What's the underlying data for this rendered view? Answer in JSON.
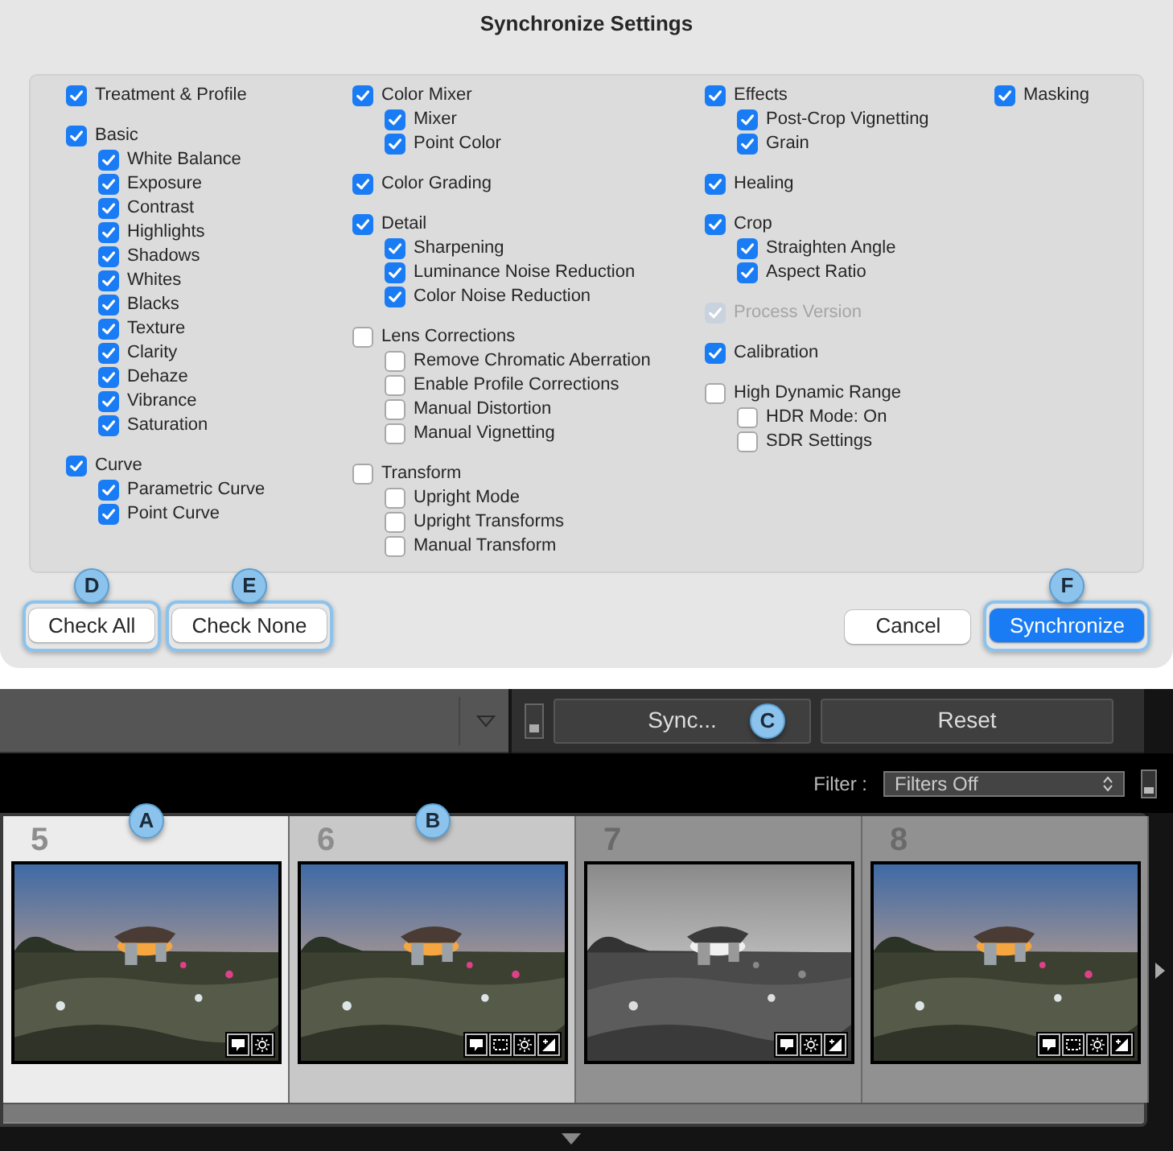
{
  "dialog": {
    "title": "Synchronize Settings",
    "columns": [
      [
        {
          "label": "Treatment & Profile",
          "checked": true,
          "disabled": false
        },
        {
          "label": "Basic",
          "checked": true,
          "disabled": false,
          "children": [
            {
              "label": "White Balance",
              "checked": true,
              "disabled": false
            },
            {
              "label": "Exposure",
              "checked": true,
              "disabled": false
            },
            {
              "label": "Contrast",
              "checked": true,
              "disabled": false
            },
            {
              "label": "Highlights",
              "checked": true,
              "disabled": false
            },
            {
              "label": "Shadows",
              "checked": true,
              "disabled": false
            },
            {
              "label": "Whites",
              "checked": true,
              "disabled": false
            },
            {
              "label": "Blacks",
              "checked": true,
              "disabled": false
            },
            {
              "label": "Texture",
              "checked": true,
              "disabled": false
            },
            {
              "label": "Clarity",
              "checked": true,
              "disabled": false
            },
            {
              "label": "Dehaze",
              "checked": true,
              "disabled": false
            },
            {
              "label": "Vibrance",
              "checked": true,
              "disabled": false
            },
            {
              "label": "Saturation",
              "checked": true,
              "disabled": false
            }
          ]
        },
        {
          "label": "Curve",
          "checked": true,
          "disabled": false,
          "children": [
            {
              "label": "Parametric Curve",
              "checked": true,
              "disabled": false
            },
            {
              "label": "Point Curve",
              "checked": true,
              "disabled": false
            }
          ]
        }
      ],
      [
        {
          "label": "Color Mixer",
          "checked": true,
          "disabled": false,
          "children": [
            {
              "label": "Mixer",
              "checked": true,
              "disabled": false
            },
            {
              "label": "Point Color",
              "checked": true,
              "disabled": false
            }
          ]
        },
        {
          "label": "Color Grading",
          "checked": true,
          "disabled": false
        },
        {
          "label": "Detail",
          "checked": true,
          "disabled": false,
          "children": [
            {
              "label": "Sharpening",
              "checked": true,
              "disabled": false
            },
            {
              "label": "Luminance Noise Reduction",
              "checked": true,
              "disabled": false
            },
            {
              "label": "Color Noise Reduction",
              "checked": true,
              "disabled": false
            }
          ]
        },
        {
          "label": "Lens Corrections",
          "checked": false,
          "disabled": false,
          "children": [
            {
              "label": "Remove Chromatic Aberration",
              "checked": false,
              "disabled": false
            },
            {
              "label": "Enable Profile Corrections",
              "checked": false,
              "disabled": false
            },
            {
              "label": "Manual Distortion",
              "checked": false,
              "disabled": false
            },
            {
              "label": "Manual Vignetting",
              "checked": false,
              "disabled": false
            }
          ]
        },
        {
          "label": "Transform",
          "checked": false,
          "disabled": false,
          "children": [
            {
              "label": "Upright Mode",
              "checked": false,
              "disabled": false
            },
            {
              "label": "Upright Transforms",
              "checked": false,
              "disabled": false
            },
            {
              "label": "Manual Transform",
              "checked": false,
              "disabled": false
            }
          ]
        }
      ],
      [
        {
          "label": "Effects",
          "checked": true,
          "disabled": false,
          "children": [
            {
              "label": "Post-Crop Vignetting",
              "checked": true,
              "disabled": false
            },
            {
              "label": "Grain",
              "checked": true,
              "disabled": false
            }
          ]
        },
        {
          "label": "Healing",
          "checked": true,
          "disabled": false
        },
        {
          "label": "Crop",
          "checked": true,
          "disabled": false,
          "children": [
            {
              "label": "Straighten Angle",
              "checked": true,
              "disabled": false
            },
            {
              "label": "Aspect Ratio",
              "checked": true,
              "disabled": false
            }
          ]
        },
        {
          "label": "Process Version",
          "checked": true,
          "disabled": true
        },
        {
          "label": "Calibration",
          "checked": true,
          "disabled": false
        },
        {
          "label": "High Dynamic Range",
          "checked": false,
          "disabled": false,
          "children": [
            {
              "label": "HDR Mode: On",
              "checked": false,
              "disabled": false
            },
            {
              "label": "SDR Settings",
              "checked": false,
              "disabled": false
            }
          ]
        }
      ],
      [
        {
          "label": "Masking",
          "checked": true,
          "disabled": false
        }
      ]
    ],
    "left_buttons": [
      {
        "label": "Check All",
        "callout": "D",
        "primary": false
      },
      {
        "label": "Check None",
        "callout": "E",
        "primary": false
      }
    ],
    "right_buttons": [
      {
        "label": "Cancel",
        "primary": false
      },
      {
        "label": "Synchronize",
        "callout": "F",
        "primary": true
      }
    ]
  },
  "toolbar": {
    "sync_button": {
      "label": "Sync...",
      "callout": "C"
    },
    "reset_button": {
      "label": "Reset"
    }
  },
  "filter": {
    "label": "Filter :",
    "value": "Filters Off"
  },
  "filmstrip": [
    {
      "number": "5",
      "active": true,
      "selected": true,
      "grayscale": false,
      "callout": "A",
      "commented": true,
      "cropped": false,
      "developed": true,
      "tone_adjusted": false
    },
    {
      "number": "6",
      "active": false,
      "selected": true,
      "grayscale": false,
      "callout": "B",
      "commented": true,
      "cropped": true,
      "developed": true,
      "tone_adjusted": true
    },
    {
      "number": "7",
      "active": false,
      "selected": false,
      "grayscale": true,
      "commented": true,
      "cropped": false,
      "developed": true,
      "tone_adjusted": true
    },
    {
      "number": "8",
      "active": false,
      "selected": false,
      "grayscale": false,
      "commented": true,
      "cropped": true,
      "developed": true,
      "tone_adjusted": true
    }
  ]
}
